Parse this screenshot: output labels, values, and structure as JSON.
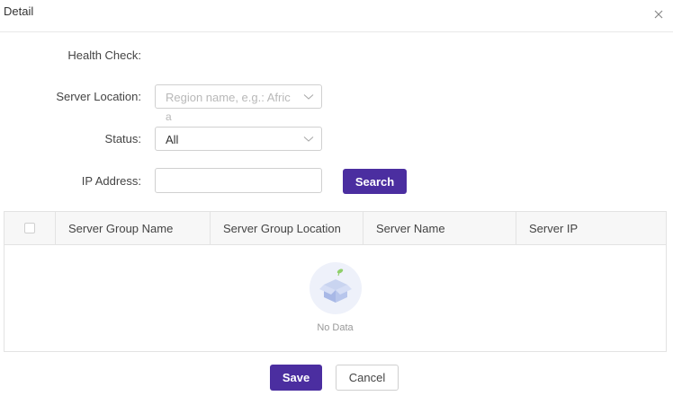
{
  "dialog": {
    "title": "Detail",
    "close_icon": "close-icon"
  },
  "form": {
    "health_check_label": "Health Check:",
    "health_check_value": "",
    "server_location_label": "Server Location:",
    "server_location_placeholder_line1": "Region name, e.g.: Afric",
    "server_location_placeholder_line2": "a",
    "status_label": "Status:",
    "status_value": "All",
    "ip_address_label": "IP Address:",
    "ip_address_value": "",
    "search_label": "Search"
  },
  "table": {
    "columns": [
      "Server Group Name",
      "Server Group Location",
      "Server Name",
      "Server IP"
    ],
    "rows": [],
    "empty_text": "No Data",
    "empty_icon": "empty-box-icon"
  },
  "footer": {
    "save_label": "Save",
    "cancel_label": "Cancel"
  },
  "colors": {
    "primary": "#4b2ea0",
    "border": "#d0d0d0",
    "header_bg": "#f7f7f7"
  }
}
